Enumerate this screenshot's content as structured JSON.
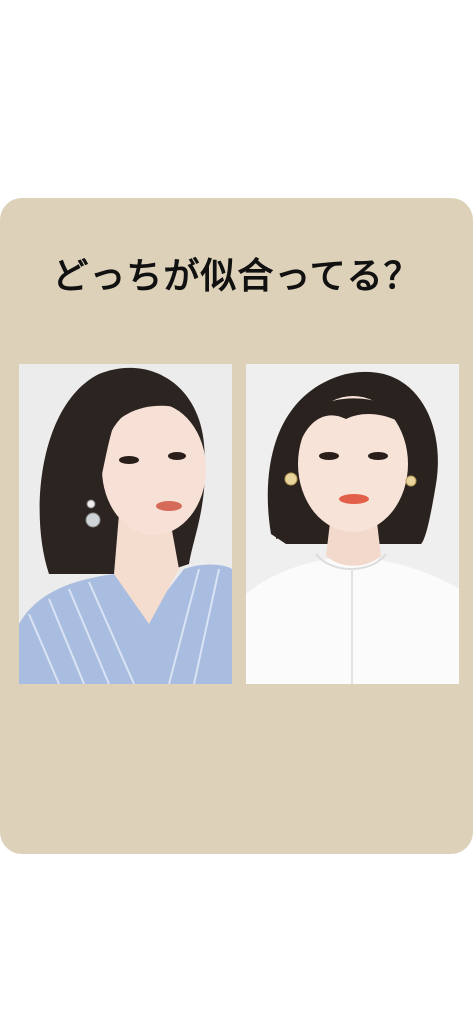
{
  "post": {
    "question": "どっちが似合ってる？"
  },
  "options": [
    {
      "id": "left",
      "image": "woman-bob-hair-blue-striped-blouse-photo"
    },
    {
      "id": "right",
      "image": "woman-bob-hair-white-collar-shirt-photo"
    }
  ],
  "colors": {
    "card_background": "#ddd2b9",
    "page_background": "#ffffff",
    "text": "#111111"
  }
}
